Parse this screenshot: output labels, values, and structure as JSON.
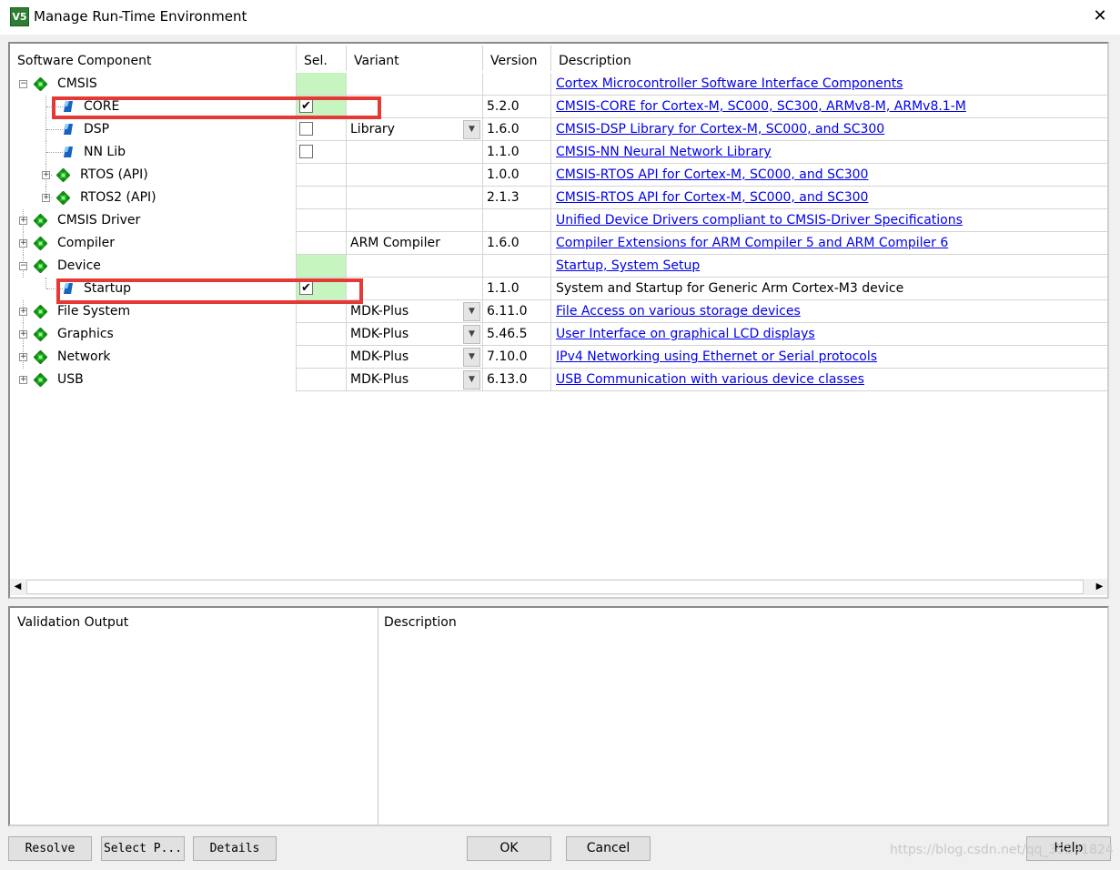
{
  "window": {
    "title": "Manage Run-Time Environment",
    "close_glyph": "✕",
    "icon_letters": "V5"
  },
  "headers": {
    "component": "Software Component",
    "sel": "Sel.",
    "variant": "Variant",
    "version": "Version",
    "description": "Description"
  },
  "rows": [
    {
      "name": "CMSIS",
      "expander": "−",
      "icon": "green-diamond-icon",
      "sel": "",
      "sel_green": true,
      "variant": "",
      "version": "",
      "description": "Cortex Microcontroller Software Interface Components",
      "link": true
    },
    {
      "name": "CORE",
      "icon": "blue-flag-icon",
      "sel": "✔",
      "sel_green": true,
      "variant": "",
      "version": "5.2.0",
      "description": "CMSIS-CORE for Cortex-M, SC000, SC300, ARMv8-M, ARMv8.1-M",
      "link": true
    },
    {
      "name": "DSP",
      "icon": "blue-flag-icon",
      "sel": "",
      "sel_green": false,
      "variant": "Library",
      "version": "1.6.0",
      "description": "CMSIS-DSP Library for Cortex-M, SC000, and SC300",
      "link": true
    },
    {
      "name": "NN Lib",
      "icon": "blue-flag-icon",
      "sel": "",
      "sel_green": false,
      "variant": "",
      "version": "1.1.0",
      "description": "CMSIS-NN Neural Network Library",
      "link": true
    },
    {
      "name": "RTOS (API)",
      "expander": "+",
      "icon": "green-diamond-icon",
      "sel": "",
      "variant": "",
      "version": "1.0.0",
      "description": "CMSIS-RTOS API for Cortex-M, SC000, and SC300",
      "link": true
    },
    {
      "name": "RTOS2 (API)",
      "expander": "+",
      "icon": "green-diamond-icon",
      "sel": "",
      "variant": "",
      "version": "2.1.3",
      "description": "CMSIS-RTOS API for Cortex-M, SC000, and SC300",
      "link": true
    },
    {
      "name": "CMSIS Driver",
      "expander": "+",
      "icon": "green-diamond-icon",
      "sel": "",
      "variant": "",
      "version": "",
      "description": "Unified Device Drivers compliant to CMSIS-Driver Specifications",
      "link": true
    },
    {
      "name": "Compiler",
      "expander": "+",
      "icon": "green-diamond-icon",
      "sel": "",
      "variant": "ARM Compiler",
      "version": "1.6.0",
      "description": "Compiler Extensions for ARM Compiler 5 and ARM Compiler 6",
      "link": true
    },
    {
      "name": "Device",
      "expander": "−",
      "icon": "green-diamond-icon",
      "sel": "",
      "sel_green": true,
      "variant": "",
      "version": "",
      "description": "Startup, System Setup",
      "link": true
    },
    {
      "name": "Startup",
      "icon": "blue-flag-icon",
      "sel": "✔",
      "sel_green": true,
      "variant": "",
      "version": "1.1.0",
      "description": "System and Startup for Generic Arm Cortex-M3 device",
      "link": false
    },
    {
      "name": "File System",
      "expander": "+",
      "icon": "green-diamond-icon",
      "sel": "",
      "variant": "MDK-Plus",
      "version": "6.11.0",
      "description": "File Access on various storage devices",
      "link": true
    },
    {
      "name": "Graphics",
      "expander": "+",
      "icon": "green-diamond-icon",
      "sel": "",
      "variant": "MDK-Plus",
      "version": "5.46.5",
      "description": "User Interface on graphical LCD displays",
      "link": true
    },
    {
      "name": "Network",
      "expander": "+",
      "icon": "green-diamond-icon",
      "sel": "",
      "variant": "MDK-Plus",
      "version": "7.10.0",
      "description": "IPv4 Networking using Ethernet or Serial protocols",
      "link": true
    },
    {
      "name": "USB",
      "expander": "+",
      "icon": "green-diamond-icon",
      "sel": "",
      "variant": "MDK-Plus",
      "version": "6.13.0",
      "description": "USB Communication with various device classes",
      "link": true
    }
  ],
  "scroll": {
    "left_glyph": "◀",
    "right_glyph": "▶"
  },
  "bottom": {
    "validation_header": "Validation Output",
    "description_header": "Description"
  },
  "buttons": {
    "resolve": "Resolve",
    "select_p": "Select P...",
    "details": "Details",
    "ok": "OK",
    "cancel": "Cancel",
    "help": "Help"
  },
  "watermark": "https://blog.csdn.net/qq_35291824"
}
